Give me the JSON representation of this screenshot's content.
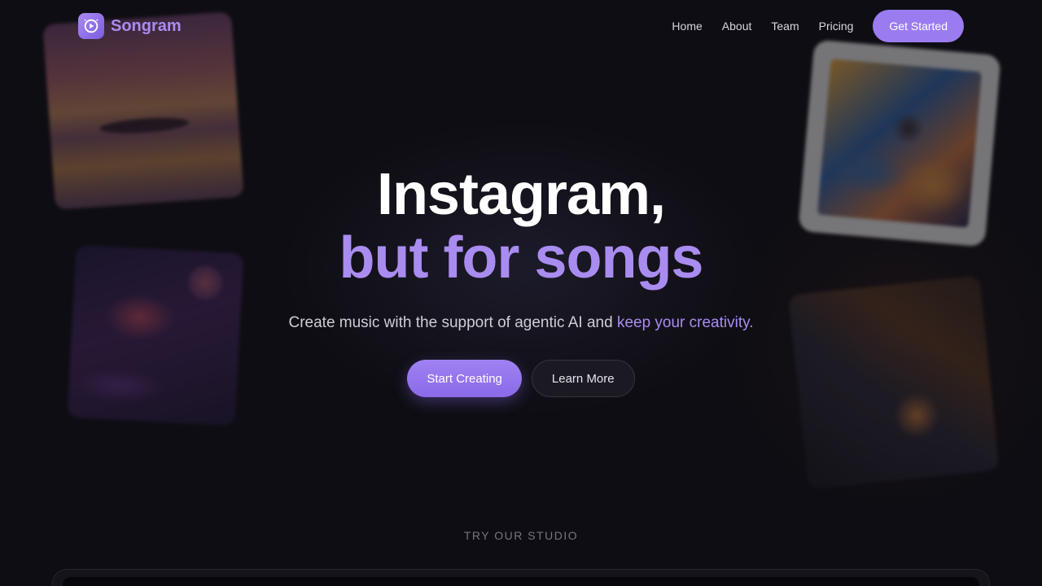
{
  "brand": {
    "name": "Songram",
    "icon": "play-icon",
    "accent": "#a98cf0"
  },
  "nav": {
    "items": [
      {
        "label": "Home"
      },
      {
        "label": "About"
      },
      {
        "label": "Team"
      },
      {
        "label": "Pricing"
      }
    ],
    "cta_label": "Get Started"
  },
  "hero": {
    "title_line1": "Instagram,",
    "title_line2": "but for songs",
    "subtitle_prefix": "Create music with the support of agentic AI and ",
    "subtitle_accent": "keep your creativity.",
    "primary_cta": "Start Creating",
    "secondary_cta": "Learn More"
  },
  "studio": {
    "label": "TRY OUR STUDIO"
  },
  "colors": {
    "background": "#0e0d13",
    "accent": "#a98cf0",
    "primary_button": "#9a7cf0"
  }
}
